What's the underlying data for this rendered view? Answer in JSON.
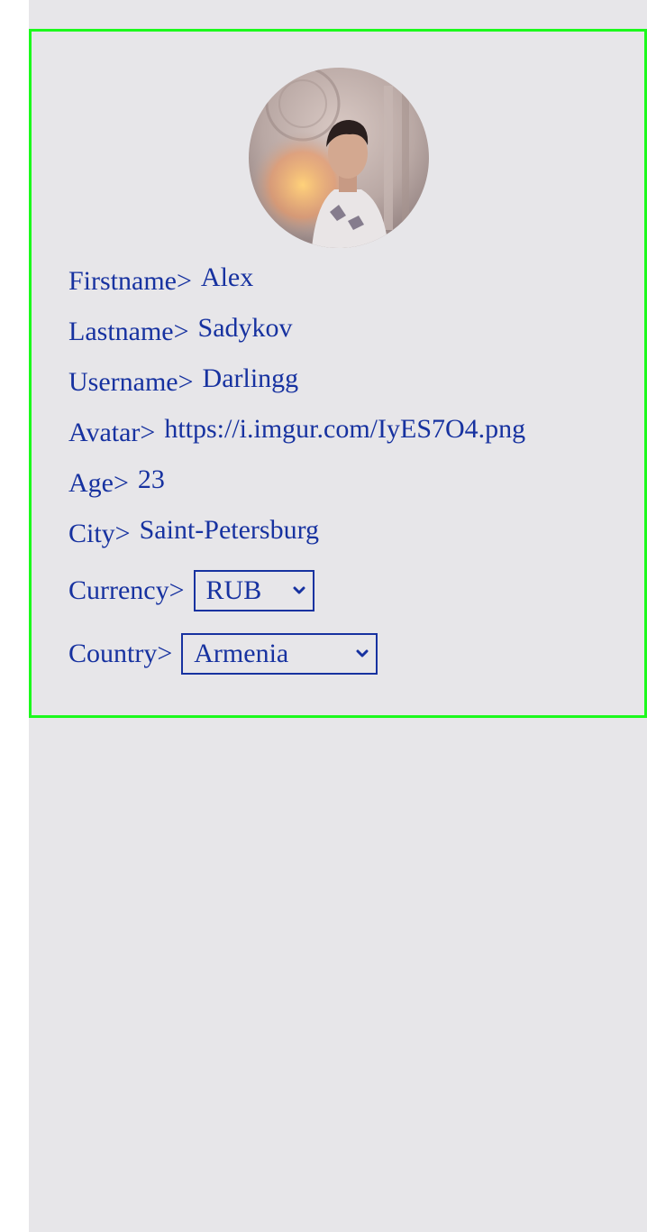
{
  "profile": {
    "firstname_label": "Firstname>",
    "firstname": "Alex",
    "lastname_label": "Lastname>",
    "lastname": "Sadykov",
    "username_label": "Username>",
    "username": "Darlingg",
    "avatar_label": "Avatar>",
    "avatar_url": "https://i.imgur.com/IyES7O4.png",
    "age_label": "Age>",
    "age": "23",
    "city_label": "City>",
    "city": "Saint-Petersburg",
    "currency_label": "Currency>",
    "currency": "RUB",
    "country_label": "Country>",
    "country": "Armenia"
  },
  "colors": {
    "text": "#1732a0",
    "card_border": "#1cf91c",
    "background": "#e7e6e9"
  },
  "icons": {
    "select_arrow": "chevron-down-icon"
  }
}
